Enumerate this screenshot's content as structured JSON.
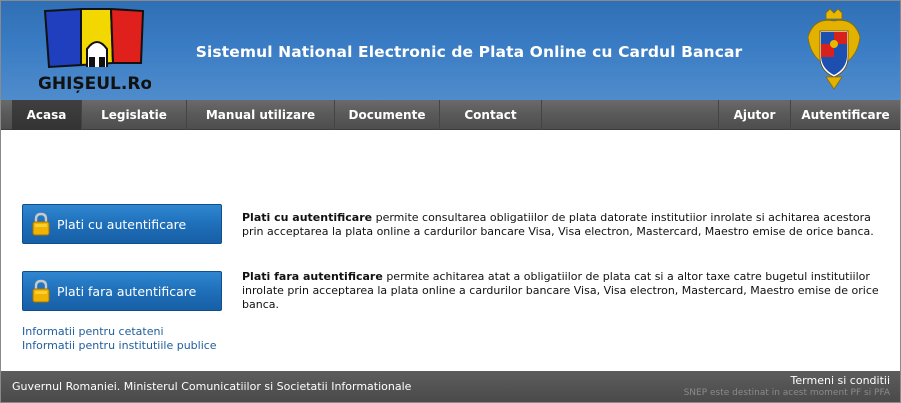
{
  "header": {
    "site_title": "Sistemul National Electronic de Plata Online cu Cardul Bancar",
    "logo_text": "GHIȘEUL.Ro"
  },
  "nav": {
    "items": [
      {
        "label": "Acasa"
      },
      {
        "label": "Legislatie"
      },
      {
        "label": "Manual utilizare"
      },
      {
        "label": "Documente"
      },
      {
        "label": "Contact"
      }
    ],
    "right_items": [
      {
        "label": "Ajutor"
      },
      {
        "label": "Autentificare"
      }
    ]
  },
  "main": {
    "auth_button_label": "Plati cu autentificare",
    "auth_title": "Plati cu autentificare",
    "auth_text": " permite consultarea obligatiilor de plata datorate institutiior inrolate si achitarea acestora prin acceptarea la plata online a cardurilor bancare Visa, Visa electron, Mastercard, Maestro emise de orice banca.",
    "noauth_button_label": "Plati fara autentificare",
    "noauth_title": "Plati fara autentificare",
    "noauth_text": " permite achitarea atat a obligatiilor de plata cat si a altor taxe catre bugetul institutiilor inrolate prin acceptarea la plata online a cardurilor bancare Visa, Visa electron, Mastercard, Maestro emise de orice banca.",
    "link_citizens": "Informatii pentru cetateni",
    "link_institutions": "Informatii pentru institutiile publice"
  },
  "footer": {
    "left_text": "Guvernul Romaniei. Ministerul Comunicatiilor si Societatii Informationale",
    "terms": "Termeni si conditii",
    "note": "SNEP este destinat in acest moment PF si PFA"
  },
  "colors": {
    "header_blue": "#3a7cc4",
    "nav_gray": "#595959",
    "button_blue": "#1f6fba",
    "link_blue": "#1f5d9b"
  },
  "icons": {
    "lock": "lock-icon",
    "coat_of_arms": "coat-of-arms-icon",
    "logo": "ghiseul-logo"
  }
}
